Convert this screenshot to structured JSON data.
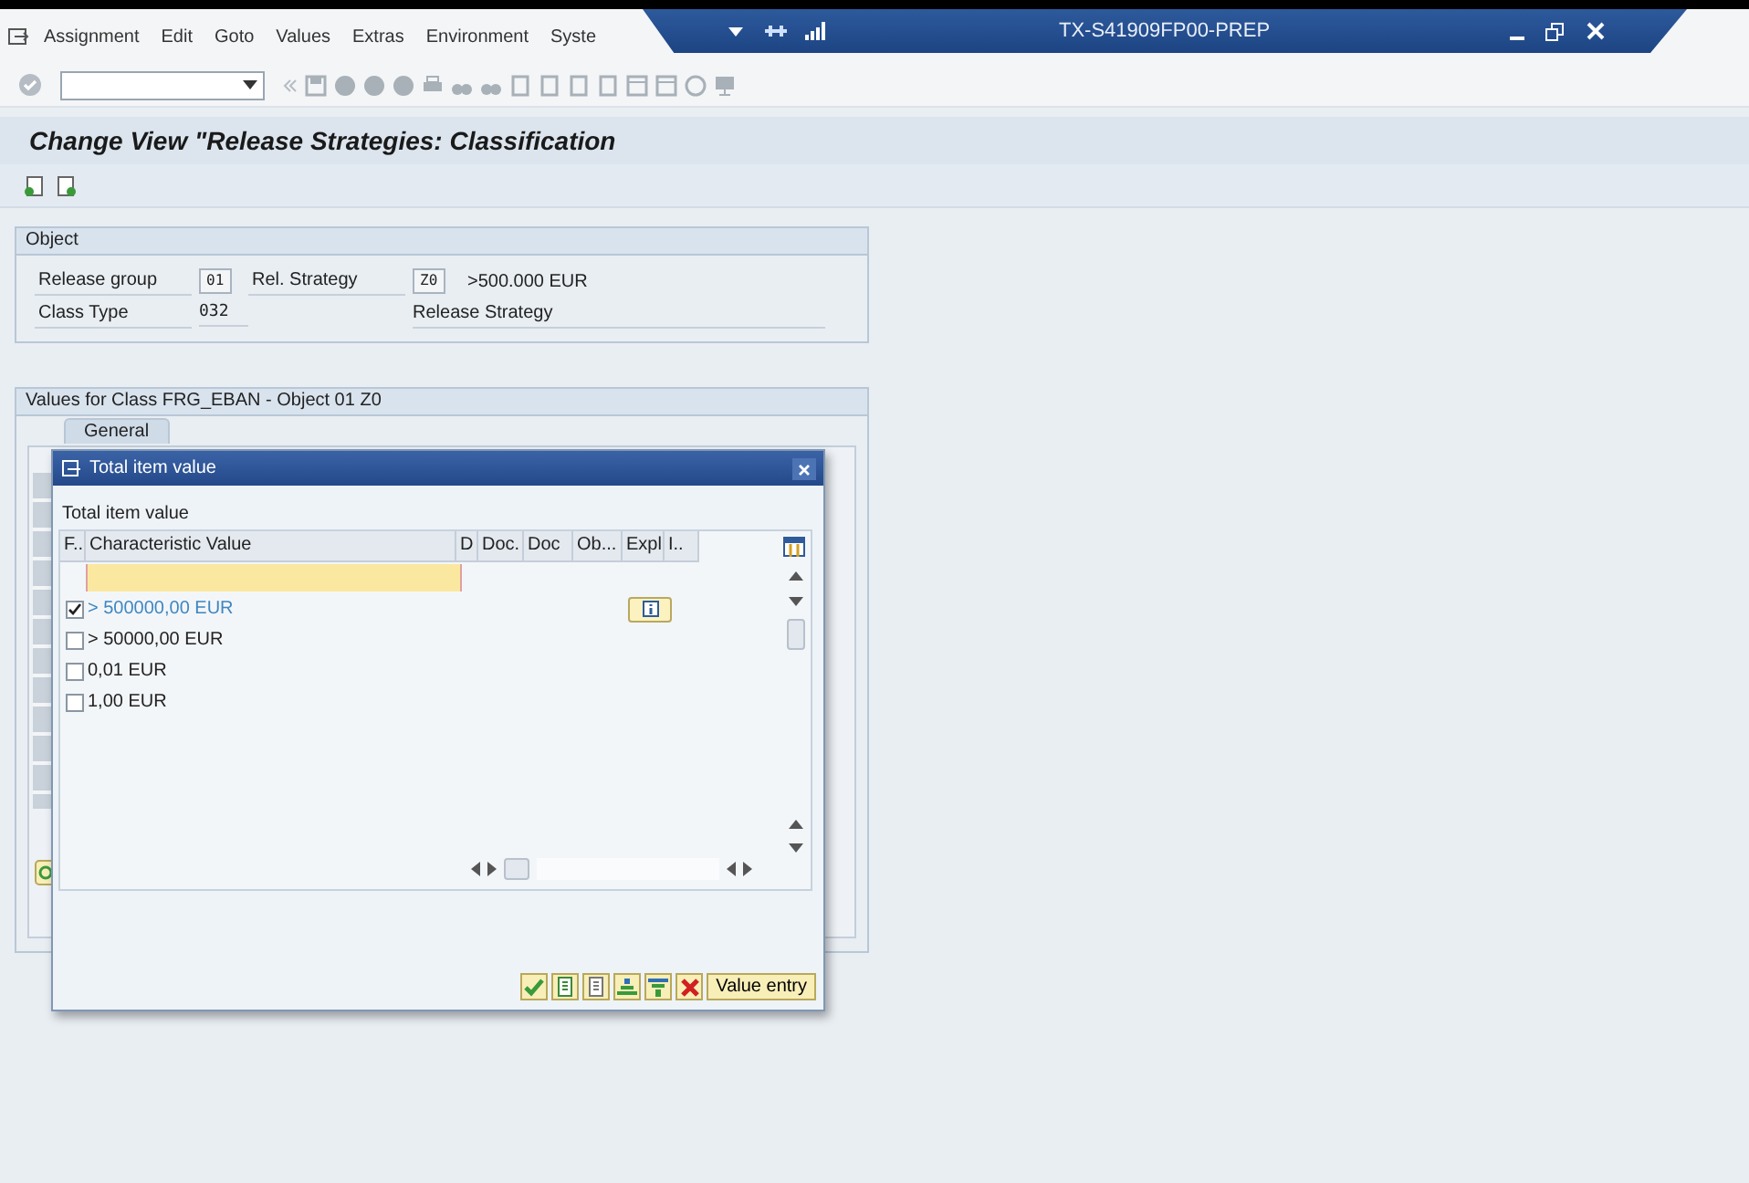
{
  "menu_bar": {
    "items": [
      "Assignment",
      "Edit",
      "Goto",
      "Values",
      "Extras",
      "Environment",
      "Syste"
    ]
  },
  "window": {
    "title": "TX-S41909FP00-PREP"
  },
  "screen_title": "Change View \"Release Strategies: Classification",
  "object_group": {
    "title": "Object",
    "rows": [
      [
        {
          "kind": "label",
          "text": "Release group"
        },
        {
          "kind": "input",
          "text": "01"
        },
        {
          "kind": "label",
          "text": "Rel. Strategy"
        },
        {
          "kind": "input",
          "text": "Z0"
        },
        {
          "kind": "text",
          "text": ">500.000 EUR"
        }
      ],
      [
        {
          "kind": "label",
          "text": "Class Type"
        },
        {
          "kind": "output",
          "text": "032"
        },
        "",
        {
          "kind": "description",
          "text": "Release Strategy"
        }
      ]
    ]
  },
  "values_group": {
    "title": "Values for Class FRG_EBAN - Object 01 Z0",
    "tabs": [
      {
        "label": "General",
        "selected": true
      }
    ]
  },
  "dialog": {
    "title": "Total item value",
    "heading": "Total item value",
    "columns": [
      "F..",
      "Characteristic Value",
      "D",
      "Doc.",
      "Doc",
      "Ob...",
      "Expl",
      "I.."
    ],
    "rows": [
      {
        "checked": true,
        "selected": true,
        "value": "> 500000,00 EUR",
        "info": true
      },
      {
        "checked": false,
        "selected": false,
        "value": "> 50000,00 EUR",
        "info": false
      },
      {
        "checked": false,
        "selected": false,
        "value": "0,01 EUR",
        "info": false
      },
      {
        "checked": false,
        "selected": false,
        "value": "1,00 EUR",
        "info": false
      }
    ],
    "value_entry_button": "Value entry"
  }
}
